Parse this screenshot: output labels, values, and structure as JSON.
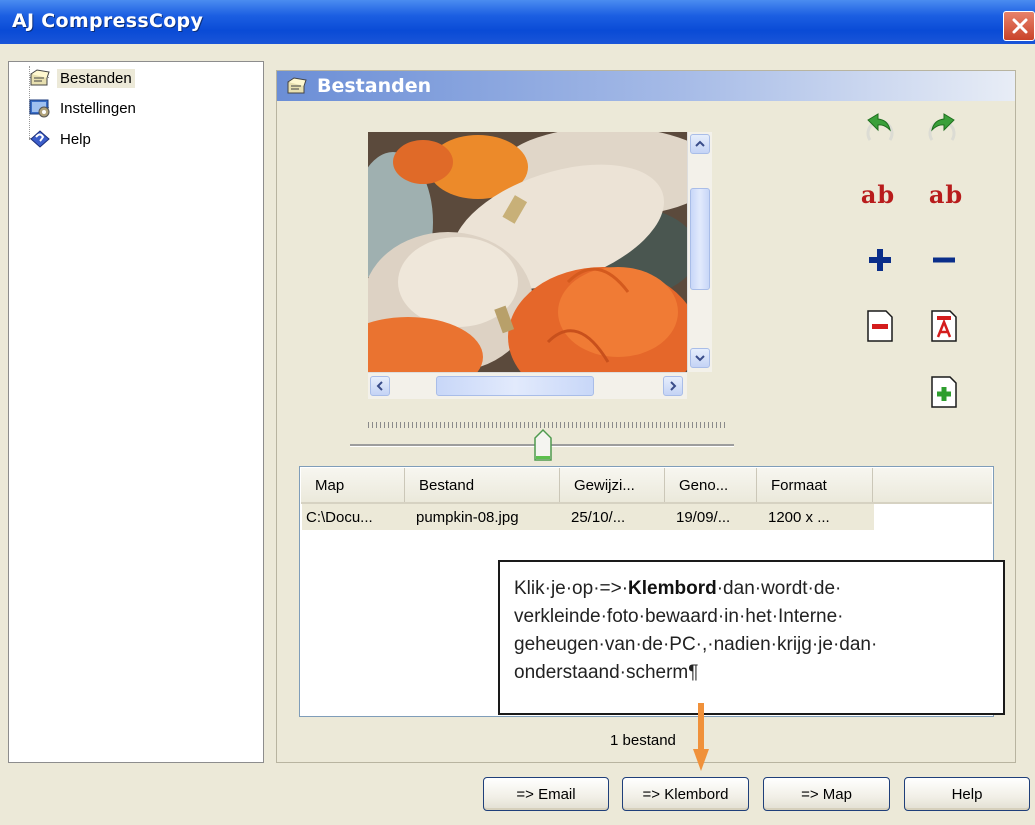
{
  "window": {
    "title": "AJ CompressCopy"
  },
  "tree": {
    "items": [
      {
        "label": "Bestanden",
        "icon": "bestanden-icon",
        "selected": true
      },
      {
        "label": "Instellingen",
        "icon": "instellingen-icon",
        "selected": false
      },
      {
        "label": "Help",
        "icon": "help-icon",
        "selected": false
      }
    ]
  },
  "panel": {
    "title": "Bestanden"
  },
  "tools": [
    {
      "name": "rotate-left-icon"
    },
    {
      "name": "rotate-right-icon"
    },
    {
      "name": "ab-text-icon",
      "text": "ab"
    },
    {
      "name": "ab-text-icon",
      "text": "ab"
    },
    {
      "name": "plus-icon"
    },
    {
      "name": "minus-icon"
    },
    {
      "name": "remove-file-icon"
    },
    {
      "name": "pdf-text-icon"
    },
    {
      "name": "add-file-icon"
    }
  ],
  "table": {
    "columns": [
      "Map",
      "Bestand",
      "Gewijzi...",
      "Geno...",
      "Formaat"
    ],
    "rows": [
      [
        "C:\\Docu...",
        "pumpkin-08.jpg",
        "25/10/...",
        "19/09/...",
        "1200 x ..."
      ]
    ]
  },
  "callout": {
    "before": "Klik·je·op·=>·",
    "bold": "Klembord",
    "after": "·dan·wordt·de· verkleinde·foto·bewaard·in·het·Interne· geheugen·van·de·PC·,·nadien·krijg·je·dan· onderstaand·scherm¶"
  },
  "status": {
    "text": "1 bestand"
  },
  "buttons": {
    "email": "=> Email",
    "klembord": "=> Klembord",
    "map": "=> Map",
    "help": "Help"
  },
  "colors": {
    "titlebar": "#0a4bd6",
    "accent_arrow": "#f0913a",
    "ab_red": "#b81c1c",
    "plus_blue": "#0a2e8a"
  }
}
